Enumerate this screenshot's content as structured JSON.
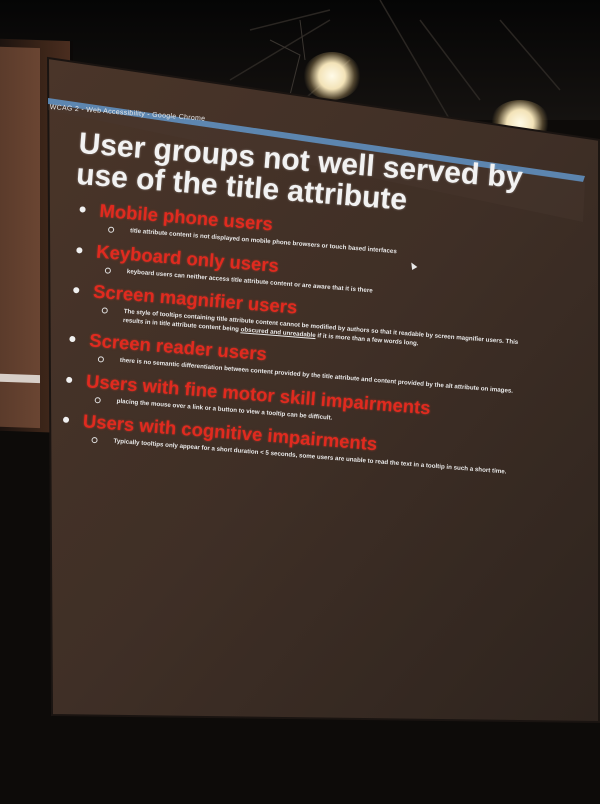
{
  "slide": {
    "window_title": "WCAG 2 - Web Accessibility - Google Chrome",
    "title": "User groups not well served by use of the title attribute",
    "items": [
      {
        "heading": "Mobile phone users",
        "detail": "title attribute content is not displayed on mobile phone browsers or touch based interfaces",
        "detail_underlined": ""
      },
      {
        "heading": "Keyboard only users",
        "detail": "keyboard users can neither access title attribute content or are aware that it is there",
        "detail_underlined": ""
      },
      {
        "heading": "Screen magnifier users",
        "detail": "The style of tooltips containing title attribute content cannot be modified by authors so that it readable by screen magnifier users. This results in in title attribute content being",
        "detail_underlined": "obscured and unreadable",
        "detail_after": " if it is more than a few words long."
      },
      {
        "heading": "Screen reader users",
        "detail": "there is no semantic differentiation between content provided by the title attribute and content provided by the alt attribute on images.",
        "detail_underlined": ""
      },
      {
        "heading": "Users with fine motor skill impairments",
        "detail": "placing the mouse over a link or a button to view a tooltip can be difficult.",
        "detail_underlined": ""
      },
      {
        "heading": "Users with cognitive impairments",
        "detail": "Typically tooltips only appear for a short duration < 5 seconds, some users are unable to read the text in a tooltip in such a short time.",
        "detail_underlined": ""
      }
    ]
  },
  "colors": {
    "slide_background": "#3d2f26",
    "heading_red": "#e02a1f",
    "title_white": "#f2f2f2",
    "titlebar_blue": "#5f8fbf"
  }
}
